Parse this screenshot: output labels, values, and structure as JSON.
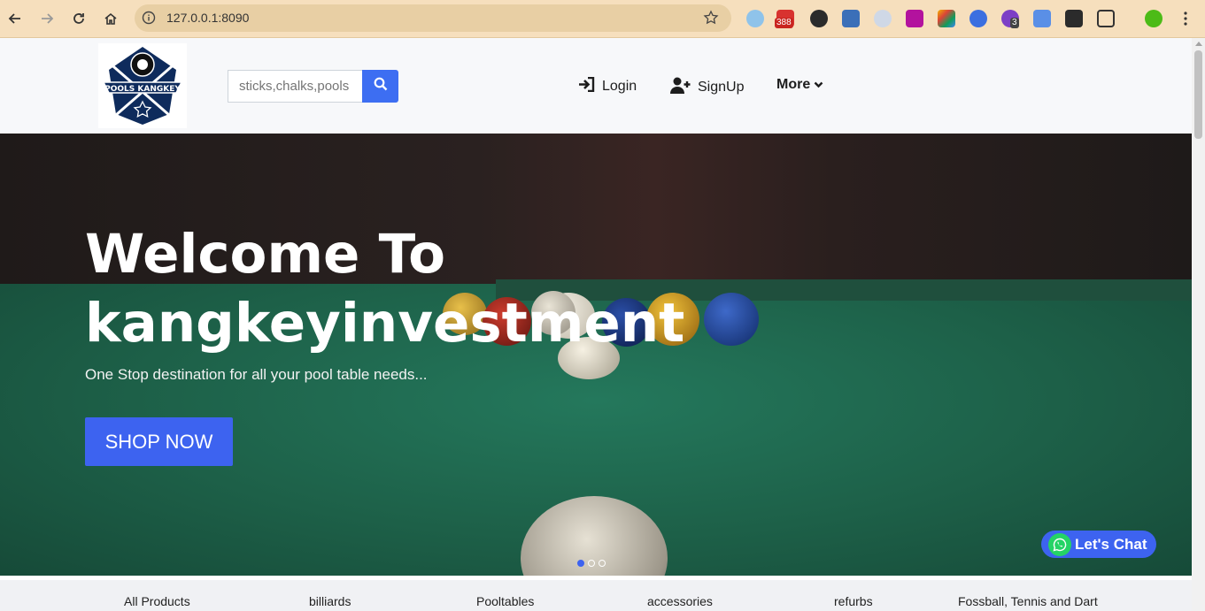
{
  "browser": {
    "url": "127.0.0.1:8090",
    "badge_388": "388",
    "badge_3": "3"
  },
  "header": {
    "search_placeholder": "sticks,chalks,pools",
    "login_label": "Login",
    "signup_label": "SignUp",
    "more_label": "More",
    "logo_text": "POOLS KANGKEY"
  },
  "hero": {
    "title_line1": "Welcome To",
    "title_line2": "kangkeyinvestment",
    "subtitle": "One Stop destination for all your pool table needs...",
    "shop_label": "SHOP NOW",
    "slides": 3,
    "active_slide": 1
  },
  "chat": {
    "label": "Let's Chat"
  },
  "categories": [
    "All Products",
    "billiards",
    "Pooltables",
    "accessories",
    "refurbs",
    "Fossball, Tennis and Dart"
  ],
  "colors": {
    "accent": "#3d63f0",
    "chrome": "#f6dfbd",
    "whatsapp": "#25d366"
  }
}
